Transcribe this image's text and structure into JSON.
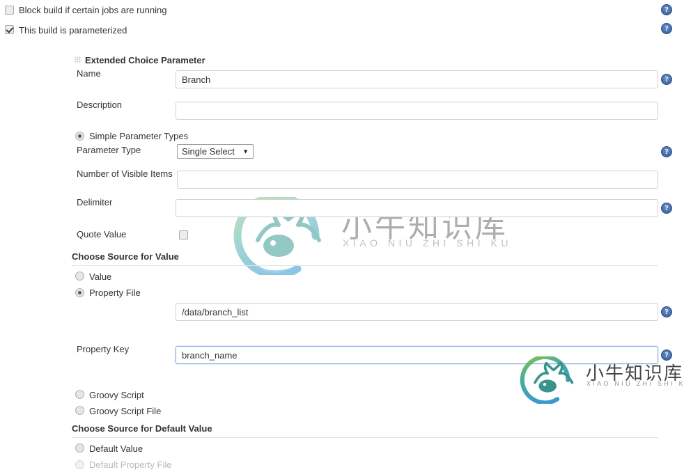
{
  "top_options": [
    {
      "label": "Block build if certain jobs are running",
      "checked": false,
      "help": true
    },
    {
      "label": "This build is parameterized",
      "checked": true,
      "help": true
    }
  ],
  "parameter_block": {
    "title": "Extended Choice Parameter",
    "grip_icon": "drag-handle-icon",
    "fields": {
      "name": {
        "label": "Name",
        "value": "Branch",
        "help": true
      },
      "description": {
        "label": "Description",
        "value": "",
        "help": false
      },
      "number_of_visible_items": {
        "label": "Number of Visible Items",
        "value": "",
        "help": false
      },
      "delimiter": {
        "label": "Delimiter",
        "value": "",
        "help": true
      },
      "quote_value": {
        "label": "Quote Value",
        "checked": false
      },
      "property_file": {
        "value": "/data/branch_list",
        "help": true
      },
      "property_key": {
        "label": "Property Key",
        "value": "branch_name",
        "help": true,
        "focused": true
      }
    },
    "simple_parameter_types": {
      "label": "Simple Parameter Types",
      "selected": true
    },
    "parameter_type": {
      "label": "Parameter Type",
      "selected": "Single Select",
      "options": [
        "Single Select"
      ],
      "help": true
    },
    "choose_source_for_value": {
      "title": "Choose Source for Value",
      "radios": [
        {
          "label": "Value",
          "selected": false,
          "disabled": false
        },
        {
          "label": "Property File",
          "selected": true,
          "disabled": false
        },
        {
          "label": "Groovy Script",
          "selected": false,
          "disabled": false
        },
        {
          "label": "Groovy Script File",
          "selected": false,
          "disabled": false
        }
      ]
    },
    "choose_source_for_default_value": {
      "title": "Choose Source for Default Value",
      "radios": [
        {
          "label": "Default Value",
          "selected": false,
          "disabled": false
        },
        {
          "label": "Default Property File",
          "selected": false,
          "disabled": true
        }
      ]
    }
  },
  "help_icon_glyph": "?",
  "watermark": {
    "cn": "小牛知识库",
    "en": "XIAO NIU ZHI SHI KU",
    "colors": {
      "green": "#8cc63f",
      "teal": "#3aa6a0",
      "blue": "#4aa3d4"
    }
  },
  "colors": {
    "focus_border": "#7fa9dd",
    "input_border": "#cfcfcf",
    "help_blue": "#3a66a0",
    "text": "#333333",
    "disabled_text": "#b9b9b9",
    "rule": "#e3e3e3"
  }
}
